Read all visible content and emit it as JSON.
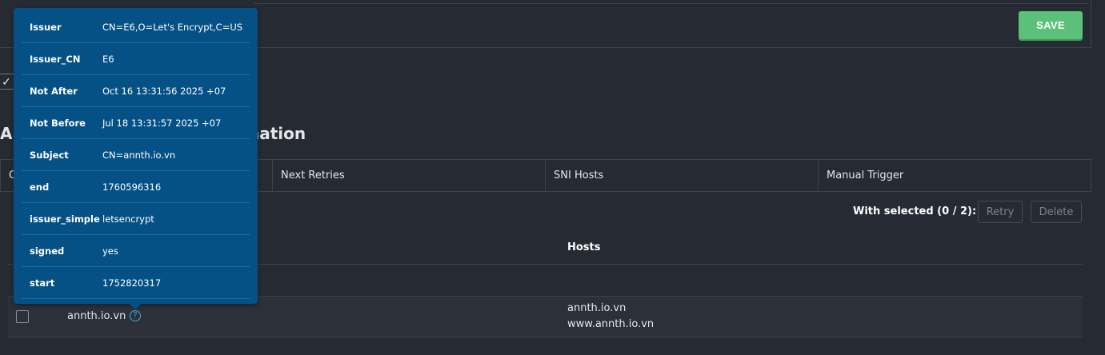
{
  "toolbar": {
    "save_label": "SAVE"
  },
  "checkbox_mark": "✓",
  "section": {
    "title_head": "Au",
    "title_tail": "nation"
  },
  "tabs": [
    {
      "label": "C"
    },
    {
      "label": "Next Retries"
    },
    {
      "label": "SNI Hosts"
    },
    {
      "label": "Manual Trigger"
    }
  ],
  "bulk": {
    "with_selected_label": "With selected (0 / 2):",
    "retry_label": "Retry",
    "delete_label": "Delete"
  },
  "table": {
    "hosts_header": "Hosts",
    "rows": [
      {
        "name": "annth.io.vn",
        "hosts": [
          "annth.io.vn",
          "www.annth.io.vn"
        ]
      }
    ]
  },
  "help_icon_glyph": "?",
  "tooltip": {
    "rows": [
      {
        "key": "Issuer",
        "value": "CN=E6,O=Let's Encrypt,C=US"
      },
      {
        "key": "Issuer_CN",
        "value": "E6"
      },
      {
        "key": "Not After",
        "value": "Oct 16 13:31:56 2025 +07"
      },
      {
        "key": "Not Before",
        "value": "Jul 18 13:31:57 2025 +07"
      },
      {
        "key": "Subject",
        "value": "CN=annth.io.vn"
      },
      {
        "key": "end",
        "value": "1760596316"
      },
      {
        "key": "issuer_simple",
        "value": "letsencrypt"
      },
      {
        "key": "signed",
        "value": "yes"
      },
      {
        "key": "start",
        "value": "1752820317"
      }
    ]
  },
  "colors": {
    "background": "#262a33",
    "save_button": "#5cbf7a",
    "tooltip_bg": "#055186",
    "help_icon": "#4aa3df"
  }
}
